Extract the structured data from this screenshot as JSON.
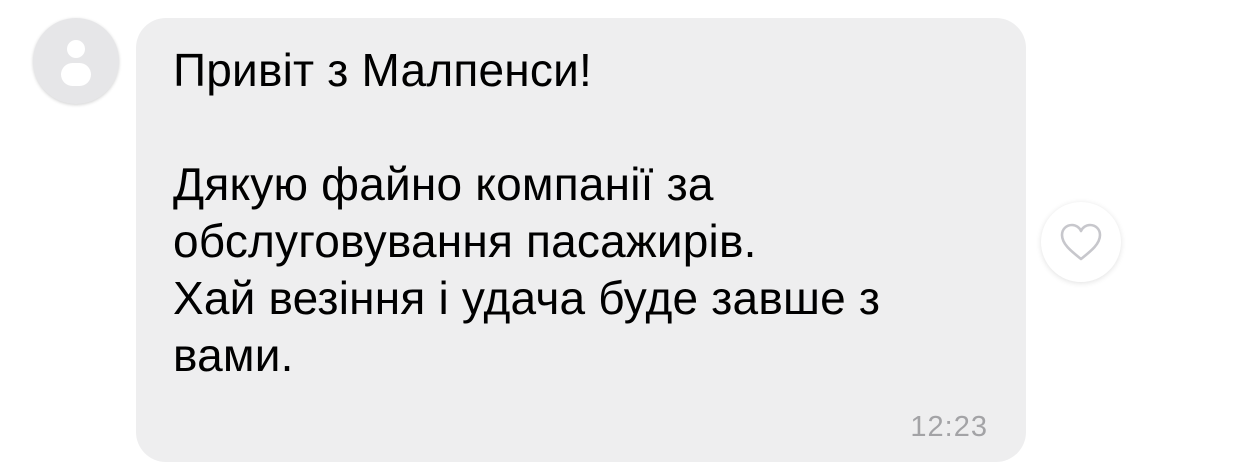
{
  "chat": {
    "avatar": {
      "icon": "user-silhouette-icon"
    },
    "message": {
      "text": "Привіт з Малпенси!\n\nДякую файно компанії за\nобслуговування пасажирів.\nХай везіння і удача буде завше з\nвами.",
      "time": "12:23"
    },
    "reaction": {
      "icon": "heart-outline-icon"
    }
  },
  "colors": {
    "bubble_background": "#eeeeef",
    "message_text": "#000000",
    "timestamp_text": "#a3a3a6",
    "avatar_background": "#e6e6e8",
    "avatar_glyph": "#ffffff",
    "heart_outline": "#c7c7cc"
  }
}
